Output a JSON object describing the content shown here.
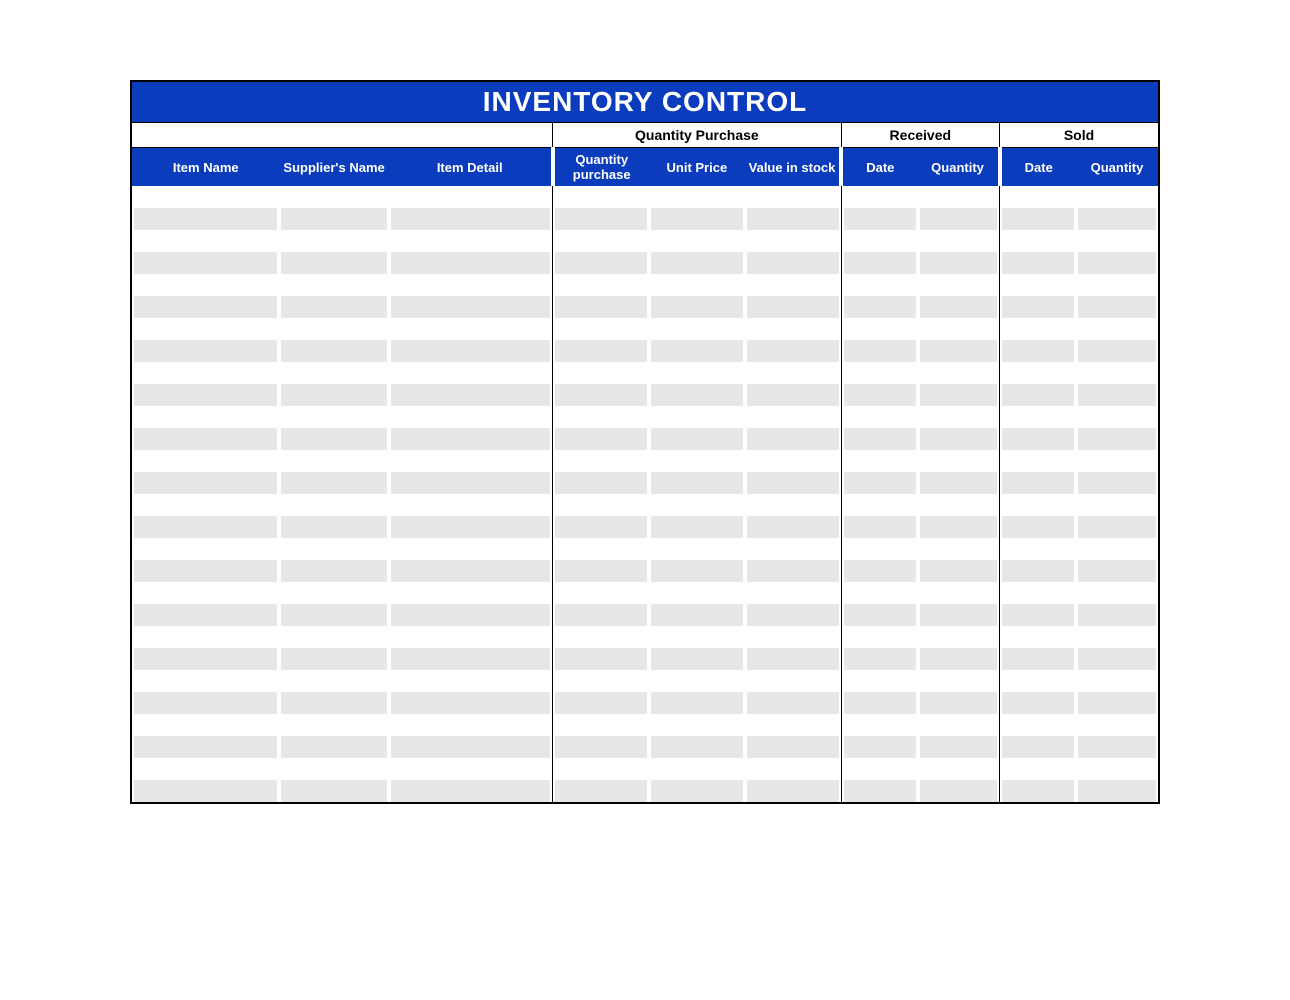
{
  "title": "INVENTORY CONTROL",
  "groups": {
    "blank": "",
    "quantity_purchase": "Quantity Purchase",
    "received": "Received",
    "sold": "Sold"
  },
  "columns": {
    "item_name": "Item Name",
    "suppliers_name": "Supplier's Name",
    "item_detail": "Item Detail",
    "qty_purchase": "Quantity purchase",
    "unit_price": "Unit Price",
    "value_in_stock": "Value in stock",
    "received_date": "Date",
    "received_qty": "Quantity",
    "sold_date": "Date",
    "sold_qty": "Quantity"
  },
  "rows": [
    {
      "item_name": "",
      "suppliers_name": "",
      "item_detail": "",
      "qty_purchase": "",
      "unit_price": "",
      "value_in_stock": "",
      "received_date": "",
      "received_qty": "",
      "sold_date": "",
      "sold_qty": ""
    },
    {
      "item_name": "",
      "suppliers_name": "",
      "item_detail": "",
      "qty_purchase": "",
      "unit_price": "",
      "value_in_stock": "",
      "received_date": "",
      "received_qty": "",
      "sold_date": "",
      "sold_qty": ""
    },
    {
      "item_name": "",
      "suppliers_name": "",
      "item_detail": "",
      "qty_purchase": "",
      "unit_price": "",
      "value_in_stock": "",
      "received_date": "",
      "received_qty": "",
      "sold_date": "",
      "sold_qty": ""
    },
    {
      "item_name": "",
      "suppliers_name": "",
      "item_detail": "",
      "qty_purchase": "",
      "unit_price": "",
      "value_in_stock": "",
      "received_date": "",
      "received_qty": "",
      "sold_date": "",
      "sold_qty": ""
    },
    {
      "item_name": "",
      "suppliers_name": "",
      "item_detail": "",
      "qty_purchase": "",
      "unit_price": "",
      "value_in_stock": "",
      "received_date": "",
      "received_qty": "",
      "sold_date": "",
      "sold_qty": ""
    },
    {
      "item_name": "",
      "suppliers_name": "",
      "item_detail": "",
      "qty_purchase": "",
      "unit_price": "",
      "value_in_stock": "",
      "received_date": "",
      "received_qty": "",
      "sold_date": "",
      "sold_qty": ""
    },
    {
      "item_name": "",
      "suppliers_name": "",
      "item_detail": "",
      "qty_purchase": "",
      "unit_price": "",
      "value_in_stock": "",
      "received_date": "",
      "received_qty": "",
      "sold_date": "",
      "sold_qty": ""
    },
    {
      "item_name": "",
      "suppliers_name": "",
      "item_detail": "",
      "qty_purchase": "",
      "unit_price": "",
      "value_in_stock": "",
      "received_date": "",
      "received_qty": "",
      "sold_date": "",
      "sold_qty": ""
    },
    {
      "item_name": "",
      "suppliers_name": "",
      "item_detail": "",
      "qty_purchase": "",
      "unit_price": "",
      "value_in_stock": "",
      "received_date": "",
      "received_qty": "",
      "sold_date": "",
      "sold_qty": ""
    },
    {
      "item_name": "",
      "suppliers_name": "",
      "item_detail": "",
      "qty_purchase": "",
      "unit_price": "",
      "value_in_stock": "",
      "received_date": "",
      "received_qty": "",
      "sold_date": "",
      "sold_qty": ""
    },
    {
      "item_name": "",
      "suppliers_name": "",
      "item_detail": "",
      "qty_purchase": "",
      "unit_price": "",
      "value_in_stock": "",
      "received_date": "",
      "received_qty": "",
      "sold_date": "",
      "sold_qty": ""
    },
    {
      "item_name": "",
      "suppliers_name": "",
      "item_detail": "",
      "qty_purchase": "",
      "unit_price": "",
      "value_in_stock": "",
      "received_date": "",
      "received_qty": "",
      "sold_date": "",
      "sold_qty": ""
    },
    {
      "item_name": "",
      "suppliers_name": "",
      "item_detail": "",
      "qty_purchase": "",
      "unit_price": "",
      "value_in_stock": "",
      "received_date": "",
      "received_qty": "",
      "sold_date": "",
      "sold_qty": ""
    },
    {
      "item_name": "",
      "suppliers_name": "",
      "item_detail": "",
      "qty_purchase": "",
      "unit_price": "",
      "value_in_stock": "",
      "received_date": "",
      "received_qty": "",
      "sold_date": "",
      "sold_qty": ""
    },
    {
      "item_name": "",
      "suppliers_name": "",
      "item_detail": "",
      "qty_purchase": "",
      "unit_price": "",
      "value_in_stock": "",
      "received_date": "",
      "received_qty": "",
      "sold_date": "",
      "sold_qty": ""
    },
    {
      "item_name": "",
      "suppliers_name": "",
      "item_detail": "",
      "qty_purchase": "",
      "unit_price": "",
      "value_in_stock": "",
      "received_date": "",
      "received_qty": "",
      "sold_date": "",
      "sold_qty": ""
    },
    {
      "item_name": "",
      "suppliers_name": "",
      "item_detail": "",
      "qty_purchase": "",
      "unit_price": "",
      "value_in_stock": "",
      "received_date": "",
      "received_qty": "",
      "sold_date": "",
      "sold_qty": ""
    },
    {
      "item_name": "",
      "suppliers_name": "",
      "item_detail": "",
      "qty_purchase": "",
      "unit_price": "",
      "value_in_stock": "",
      "received_date": "",
      "received_qty": "",
      "sold_date": "",
      "sold_qty": ""
    },
    {
      "item_name": "",
      "suppliers_name": "",
      "item_detail": "",
      "qty_purchase": "",
      "unit_price": "",
      "value_in_stock": "",
      "received_date": "",
      "received_qty": "",
      "sold_date": "",
      "sold_qty": ""
    },
    {
      "item_name": "",
      "suppliers_name": "",
      "item_detail": "",
      "qty_purchase": "",
      "unit_price": "",
      "value_in_stock": "",
      "received_date": "",
      "received_qty": "",
      "sold_date": "",
      "sold_qty": ""
    },
    {
      "item_name": "",
      "suppliers_name": "",
      "item_detail": "",
      "qty_purchase": "",
      "unit_price": "",
      "value_in_stock": "",
      "received_date": "",
      "received_qty": "",
      "sold_date": "",
      "sold_qty": ""
    },
    {
      "item_name": "",
      "suppliers_name": "",
      "item_detail": "",
      "qty_purchase": "",
      "unit_price": "",
      "value_in_stock": "",
      "received_date": "",
      "received_qty": "",
      "sold_date": "",
      "sold_qty": ""
    },
    {
      "item_name": "",
      "suppliers_name": "",
      "item_detail": "",
      "qty_purchase": "",
      "unit_price": "",
      "value_in_stock": "",
      "received_date": "",
      "received_qty": "",
      "sold_date": "",
      "sold_qty": ""
    },
    {
      "item_name": "",
      "suppliers_name": "",
      "item_detail": "",
      "qty_purchase": "",
      "unit_price": "",
      "value_in_stock": "",
      "received_date": "",
      "received_qty": "",
      "sold_date": "",
      "sold_qty": ""
    },
    {
      "item_name": "",
      "suppliers_name": "",
      "item_detail": "",
      "qty_purchase": "",
      "unit_price": "",
      "value_in_stock": "",
      "received_date": "",
      "received_qty": "",
      "sold_date": "",
      "sold_qty": ""
    },
    {
      "item_name": "",
      "suppliers_name": "",
      "item_detail": "",
      "qty_purchase": "",
      "unit_price": "",
      "value_in_stock": "",
      "received_date": "",
      "received_qty": "",
      "sold_date": "",
      "sold_qty": ""
    },
    {
      "item_name": "",
      "suppliers_name": "",
      "item_detail": "",
      "qty_purchase": "",
      "unit_price": "",
      "value_in_stock": "",
      "received_date": "",
      "received_qty": "",
      "sold_date": "",
      "sold_qty": ""
    },
    {
      "item_name": "",
      "suppliers_name": "",
      "item_detail": "",
      "qty_purchase": "",
      "unit_price": "",
      "value_in_stock": "",
      "received_date": "",
      "received_qty": "",
      "sold_date": "",
      "sold_qty": ""
    }
  ]
}
